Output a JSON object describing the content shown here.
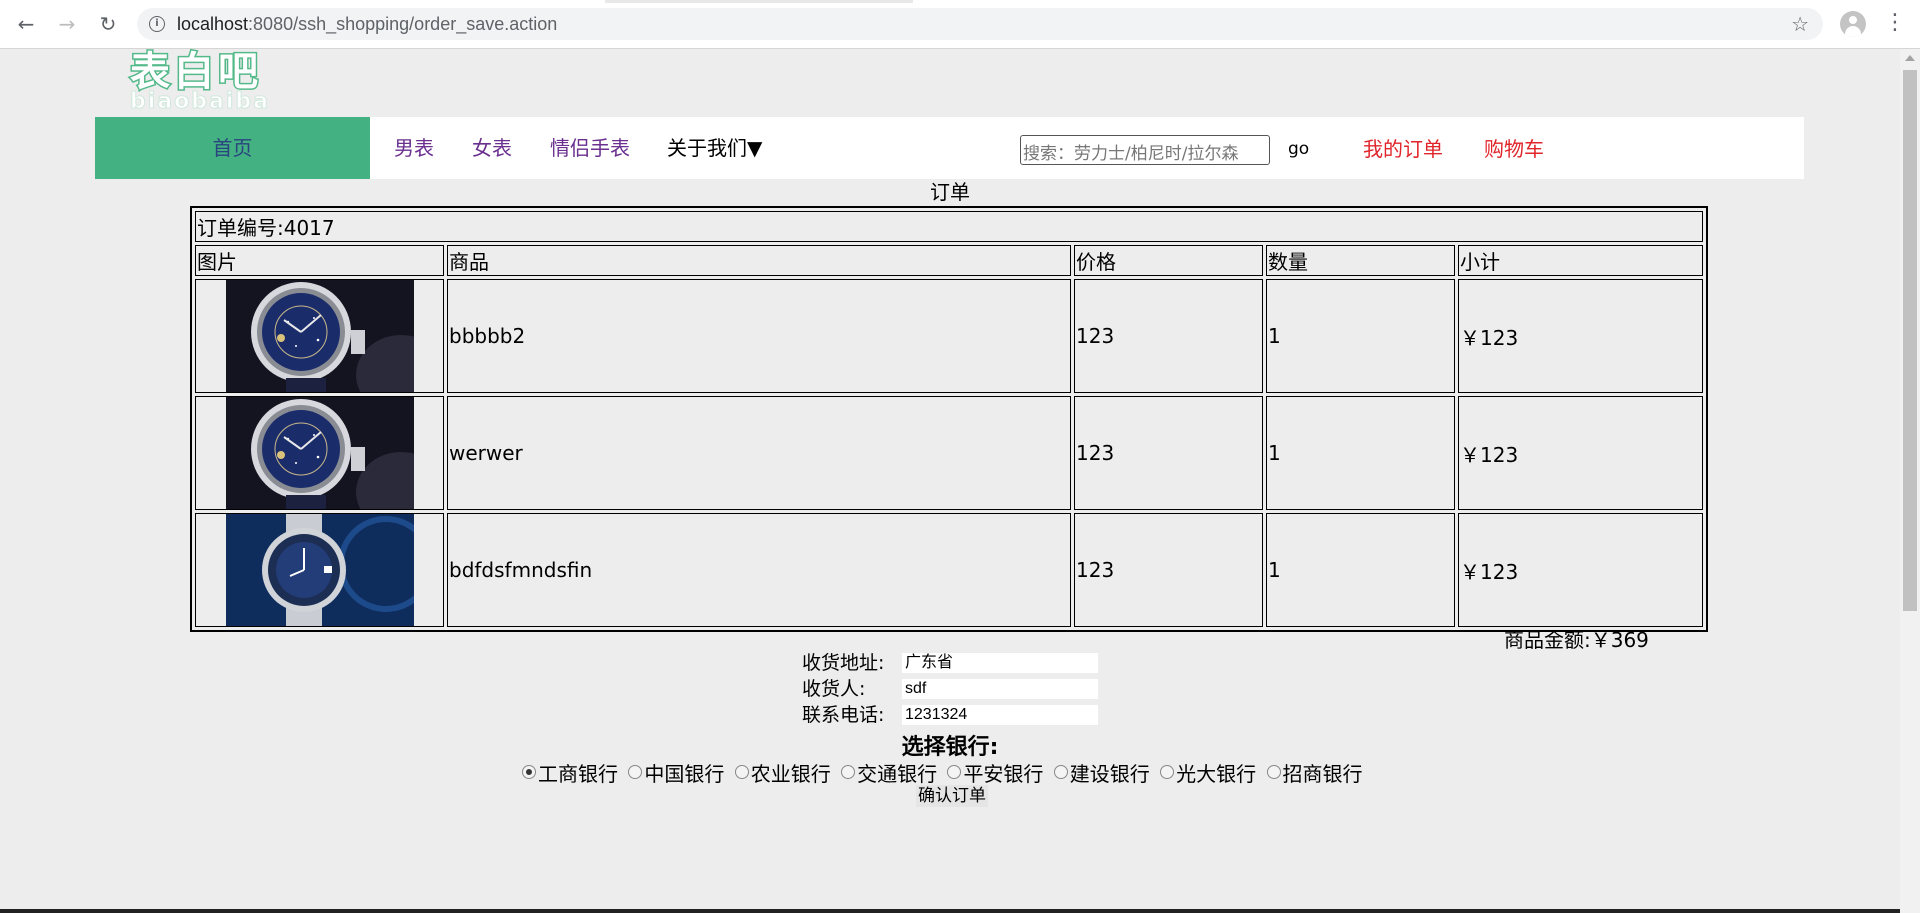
{
  "browser": {
    "url_host": "localhost",
    "url_path": ":8080/ssh_shopping/order_save.action"
  },
  "logo": {
    "main": "表白吧",
    "sub": "biaobaiba"
  },
  "nav": {
    "home": "首页",
    "men": "男表",
    "women": "女表",
    "couple": "情侣手表",
    "about": "关于我们▼",
    "search_placeholder": "搜索：劳力士/柏尼时/拉尔森",
    "go": "go",
    "my_orders": "我的订单",
    "cart": "购物车"
  },
  "order": {
    "title": "订单",
    "number_label": "订单编号:4017",
    "headers": {
      "image": "图片",
      "product": "商品",
      "price": "价格",
      "quantity": "数量",
      "subtotal": "小计"
    },
    "items": [
      {
        "name": "bbbbb2",
        "price": "123",
        "quantity": "1",
        "subtotal": "￥123",
        "image": "blue-starry-dial-watch"
      },
      {
        "name": "werwer",
        "price": "123",
        "quantity": "1",
        "subtotal": "￥123",
        "image": "blue-starry-dial-watch"
      },
      {
        "name": "bdfdsfmndsfin",
        "price": "123",
        "quantity": "1",
        "subtotal": "￥123",
        "image": "navy-diver-steel-watch"
      }
    ],
    "total": "商品金额:￥369"
  },
  "shipping": {
    "address_label": "收货地址:",
    "address_value": "广东省",
    "receiver_label": "收货人:",
    "receiver_value": "sdf",
    "phone_label": "联系电话:",
    "phone_value": "1231324"
  },
  "bank": {
    "title": "选择银行:",
    "options": [
      "工商银行",
      "中国银行",
      "农业银行",
      "交通银行",
      "平安银行",
      "建设银行",
      "光大银行",
      "招商银行"
    ],
    "selected": "工商银行"
  },
  "confirm_label": "确认订单"
}
